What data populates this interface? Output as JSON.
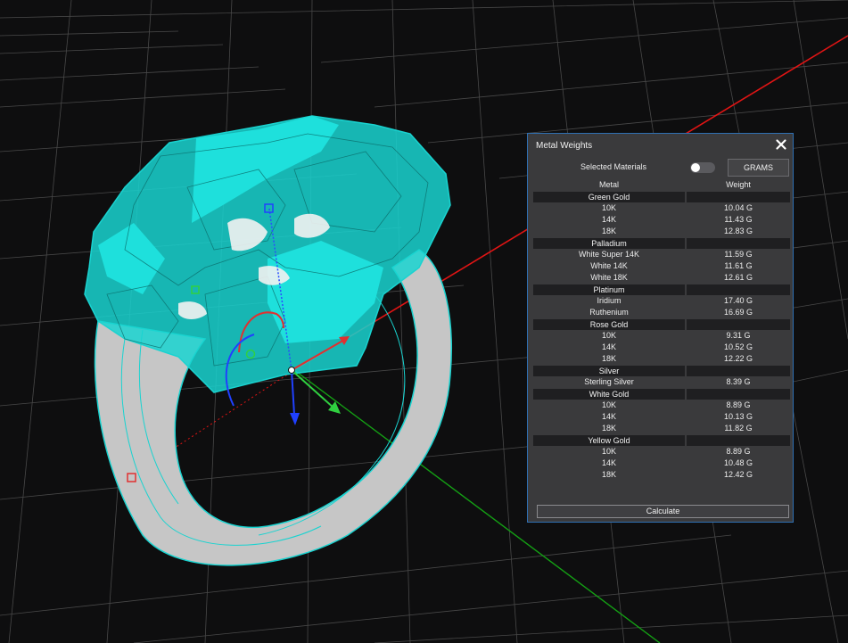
{
  "panel": {
    "title": "Metal Weights",
    "selected_materials_label": "Selected Materials",
    "selected_materials_on": false,
    "units_button": "GRAMS",
    "calculate_button": "Calculate",
    "columns": {
      "metal": "Metal",
      "weight": "Weight"
    },
    "groups": [
      {
        "name": "Green Gold",
        "rows": [
          {
            "metal": "10K",
            "weight": "10.04 G"
          },
          {
            "metal": "14K",
            "weight": "11.43 G"
          },
          {
            "metal": "18K",
            "weight": "12.83 G"
          }
        ]
      },
      {
        "name": "Palladium",
        "rows": [
          {
            "metal": "White Super 14K",
            "weight": "11.59 G"
          },
          {
            "metal": "White 14K",
            "weight": "11.61 G"
          },
          {
            "metal": "White 18K",
            "weight": "12.61 G"
          }
        ]
      },
      {
        "name": "Platinum",
        "rows": [
          {
            "metal": "Iridium",
            "weight": "17.40 G"
          },
          {
            "metal": "Ruthenium",
            "weight": "16.69 G"
          }
        ]
      },
      {
        "name": "Rose Gold",
        "rows": [
          {
            "metal": "10K",
            "weight": "9.31 G"
          },
          {
            "metal": "14K",
            "weight": "10.52 G"
          },
          {
            "metal": "18K",
            "weight": "12.22 G"
          }
        ]
      },
      {
        "name": "Silver",
        "rows": [
          {
            "metal": "Sterling Silver",
            "weight": "8.39 G"
          }
        ]
      },
      {
        "name": "White Gold",
        "rows": [
          {
            "metal": "10K",
            "weight": "8.89 G"
          },
          {
            "metal": "14K",
            "weight": "10.13 G"
          },
          {
            "metal": "18K",
            "weight": "11.82 G"
          }
        ]
      },
      {
        "name": "Yellow Gold",
        "rows": [
          {
            "metal": "10K",
            "weight": "8.89 G"
          },
          {
            "metal": "14K",
            "weight": "10.48 G"
          },
          {
            "metal": "18K",
            "weight": "12.42 G"
          }
        ]
      }
    ]
  },
  "colors": {
    "background": "#0e0e0f",
    "grid": "#5a5a5a",
    "x_axis": "#e01414",
    "y_axis": "#14a014",
    "ring_selection": "#19d3d0",
    "ring_metal": "#c8c8c8",
    "gizmo_x": "#e03030",
    "gizmo_y": "#30d040",
    "gizmo_z": "#2040ff",
    "panel_border": "#2f6fb2"
  },
  "icons": {
    "close": "close-icon"
  }
}
